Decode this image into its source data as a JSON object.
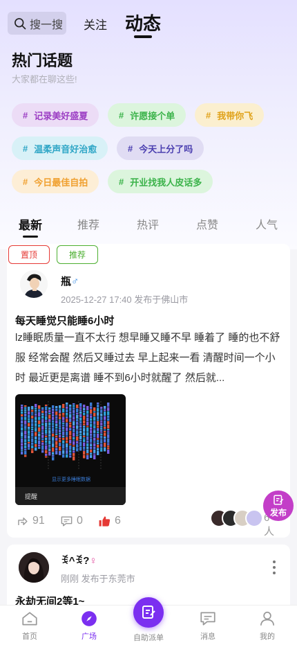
{
  "header": {
    "search_placeholder": "搜一搜",
    "tab_follow": "关注",
    "tab_dynamic": "动态"
  },
  "hot_topics": {
    "title": "热门话题",
    "subtitle": "大家都在聊这些!",
    "tags": [
      {
        "label": "记录美好盛夏",
        "color": "#9c3fc4",
        "bg": "#ecdcf6"
      },
      {
        "label": "许愿接个单",
        "color": "#3bb34a",
        "bg": "#dcf5dd"
      },
      {
        "label": "我带你飞",
        "color": "#e0a21a",
        "bg": "#fbefcf"
      },
      {
        "label": "温柔声音好治愈",
        "color": "#2fa6c6",
        "bg": "#d8f1f7"
      },
      {
        "label": "今天上分了吗",
        "color": "#4b3fb0",
        "bg": "#e0dcf3"
      },
      {
        "label": "今日最佳自拍",
        "color": "#f0a030",
        "bg": "#fdeed6"
      },
      {
        "label": "开业找我人皮话多",
        "color": "#3bb34a",
        "bg": "#dcf5dd"
      }
    ]
  },
  "feed_tabs": [
    "最新",
    "推荐",
    "热评",
    "点赞",
    "人气"
  ],
  "post1": {
    "badge_pinned": "置顶",
    "badge_recommended": "推荐",
    "username": "瓶",
    "gender_symbol": "♂",
    "meta": "2025-12-27 17:40 发布于佛山市",
    "title": "每天睡觉只能睡6小时",
    "body": "lz睡眠质量一直不太行 想早睡又睡不早 睡着了 睡的也不舒服 经常会醒 然后又睡过去 早上起来一看 清醒时间一个小时 最近更是离谱 睡不到6小时就醒了 然后就...",
    "image_caption": "显示更多睡眠数据",
    "image_footer": "提醒",
    "shares": "91",
    "comments": "0",
    "likes": "6",
    "viewers": "6人"
  },
  "publish_fab": "发布",
  "post2": {
    "username": "ꉂ^ꉂ?",
    "gender_symbol": "♀",
    "meta": "刚刚 发布于东莞市",
    "title": "永劫无间2等1~"
  },
  "bottom_nav": {
    "home": "首页",
    "plaza": "广场",
    "dispatch": "自助派单",
    "messages": "消息",
    "mine": "我的"
  },
  "colors": {
    "accent": "#7b2ff0",
    "like_red": "#e53935",
    "pinned_red": "#e53935",
    "recommend_green": "#4caf30",
    "publish_fab": "#c33ec8"
  }
}
